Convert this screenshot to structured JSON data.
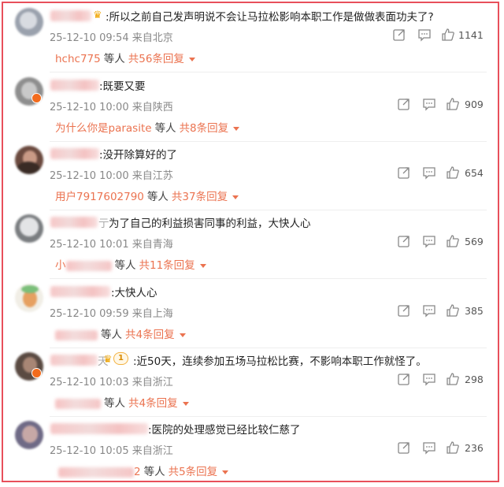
{
  "comments": [
    {
      "text": ":所以之前自己发声明说不会让马拉松影响本职工作是做做表面功夫了?",
      "time": "25-12-10 09:54",
      "location": "来自北京",
      "likes": "1141",
      "reply_user": "hchc775",
      "reply_deng": "等人",
      "reply_count": "共56条回复"
    },
    {
      "text": ":既要又要",
      "time": "25-12-10 10:00",
      "location": "来自陕西",
      "likes": "909",
      "reply_user": "为什么你是parasite",
      "reply_deng": "等人",
      "reply_count": "共8条回复"
    },
    {
      "text": ":没开除算好的了",
      "time": "25-12-10 10:00",
      "location": "来自江苏",
      "likes": "654",
      "reply_user": "用户7917602790",
      "reply_deng": "等人",
      "reply_count": "共37条回复"
    },
    {
      "text": "为了自己的利益损害同事的利益，大快人心",
      "name_tail": "亍",
      "time": "25-12-10 10:01",
      "location": "来自青海",
      "likes": "569",
      "reply_user": "小",
      "reply_deng": "等人",
      "reply_count": "共11条回复"
    },
    {
      "text": ":大快人心",
      "time": "25-12-10 09:59",
      "location": "来自上海",
      "likes": "385",
      "reply_user": "",
      "reply_deng": "等人",
      "reply_count": "共4条回复"
    },
    {
      "text": ":近50天，连续参加五场马拉松比赛，不影响本职工作就怪了。",
      "name_tail": "天",
      "vip": "1",
      "time": "25-12-10 10:03",
      "location": "来自浙江",
      "likes": "298",
      "reply_user": "",
      "reply_deng": "等人",
      "reply_count": "共4条回复"
    },
    {
      "text": ":医院的处理感觉已经比较仁慈了",
      "time": "25-12-10 10:05",
      "location": "来自浙江",
      "likes": "236",
      "reply_user": "2",
      "reply_deng": "等人",
      "reply_count": "共5条回复"
    }
  ],
  "icons": {
    "share": "share-icon",
    "comment": "comment-icon",
    "like": "thumbs-up-icon",
    "crown": "crown-icon"
  },
  "colors": {
    "accent": "#eb7350",
    "frame": "#e8505b",
    "meta": "#888888"
  }
}
